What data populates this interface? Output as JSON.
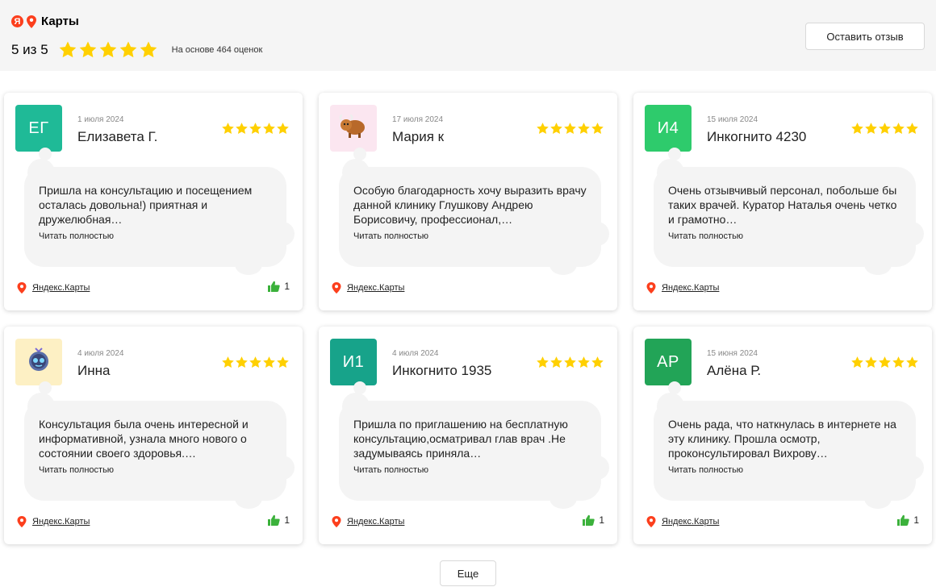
{
  "header": {
    "brand_name": "Карты",
    "ya_letter": "Я",
    "rating_text": "5 из 5",
    "rating_value": 5,
    "rating_max": 5,
    "rating_basis": "На основе 464 оценок",
    "leave_review_label": "Оставить отзыв"
  },
  "colors": {
    "star": "#ffd000",
    "logo_red": "#fc3f1d",
    "like_green": "#3bb13b"
  },
  "reviews": [
    {
      "initials": "ЕГ",
      "avatar_color": "#1fba97",
      "avatar_type": "initials",
      "date": "1 июля 2024",
      "author": "Елизавета Г.",
      "rating": 5,
      "text": "Пришла на консультацию и посещением осталась довольна!) приятная и дружелюбная…",
      "read_more": "Читать полностью",
      "source": "Яндекс.Карты",
      "likes": "1"
    },
    {
      "initials": "",
      "avatar_color": "#fbe6f0",
      "avatar_type": "yak-icon",
      "date": "17 июля 2024",
      "author": "Мария к",
      "rating": 5,
      "text": "Особую благодарность хочу выразить врачу данной клинику Глушкову Андрею Борисовичу, профессионал,…",
      "read_more": "Читать полностью",
      "source": "Яндекс.Карты",
      "likes": ""
    },
    {
      "initials": "И4",
      "avatar_color": "#2ecb6c",
      "avatar_type": "initials",
      "date": "15 июля 2024",
      "author": "Инкогнито 4230",
      "rating": 5,
      "text": "Очень отзывчивый персонал, побольше бы таких врачей. Куратор Наталья очень четко и грамотно…",
      "read_more": "Читать полностью",
      "source": "Яндекс.Карты",
      "likes": ""
    },
    {
      "initials": "",
      "avatar_color": "#fdf0c4",
      "avatar_type": "robot-icon",
      "date": "4 июля 2024",
      "author": "Инна",
      "rating": 5,
      "text": "Консультация была очень интересной и информативной, узнала много нового о состоянии своего здоровья.…",
      "read_more": "Читать полностью",
      "source": "Яндекс.Карты",
      "likes": "1"
    },
    {
      "initials": "И1",
      "avatar_color": "#17a38a",
      "avatar_type": "initials",
      "date": "4 июля 2024",
      "author": "Инкогнито 1935",
      "rating": 5,
      "text": "Пришла по приглашению на бесплатную консультацию,осматривал глав врач .Не задумываясь приняла…",
      "read_more": "Читать полностью",
      "source": "Яндекс.Карты",
      "likes": "1"
    },
    {
      "initials": "АР",
      "avatar_color": "#22a457",
      "avatar_type": "initials",
      "date": "15 июня 2024",
      "author": "Алёна Р.",
      "rating": 5,
      "text": "Очень рада, что наткнулась в интернете на эту клинику. Прошла осмотр, проконсультировал Вихрову…",
      "read_more": "Читать полностью",
      "source": "Яндекс.Карты",
      "likes": "1"
    }
  ],
  "more_label": "Еще"
}
